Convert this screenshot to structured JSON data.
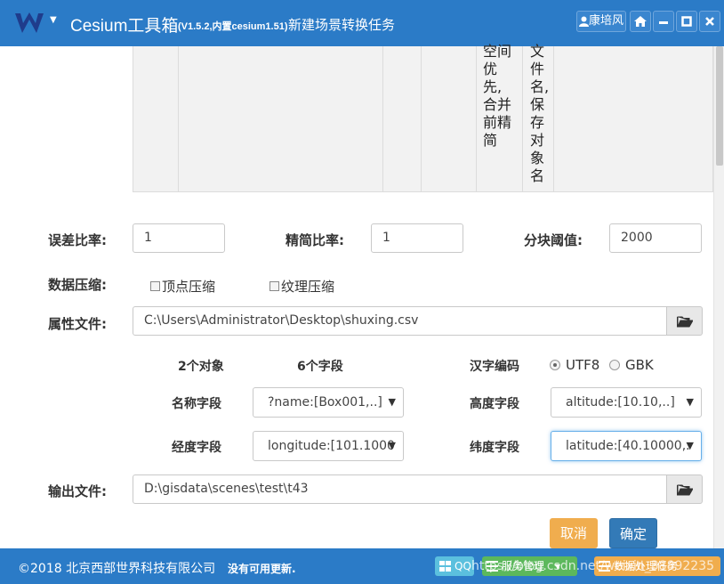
{
  "app": {
    "title": "Cesium工具箱",
    "version": "(V1.5.2,内置cesium1.51)",
    "subtitle": "新建场景转换任务",
    "user": "康培风"
  },
  "grid": {
    "col_a": "空间优先,合并前精简",
    "col_b": "文件名,保存对象名"
  },
  "form": {
    "error_ratio": {
      "label": "误差比率:",
      "value": "1"
    },
    "simplify_ratio": {
      "label": "精简比率:",
      "value": "1"
    },
    "tile_threshold": {
      "label": "分块阈值:",
      "value": "2000"
    },
    "compression": {
      "label": "数据压缩:",
      "vertex": "顶点压缩",
      "texture": "纹理压缩"
    },
    "attr_file": {
      "label": "属性文件:",
      "value": "C:\\Users\\Administrator\\Desktop\\shuxing.csv"
    },
    "object_count": "2个对象",
    "field_count": "6个字段",
    "encoding": {
      "label": "汉字编码",
      "options": [
        "UTF8",
        "GBK"
      ],
      "selected": "UTF8"
    },
    "name_field": {
      "label": "名称字段",
      "value": "?name:[Box001,..]"
    },
    "height_field": {
      "label": "高度字段",
      "value": "altitude:[10.10,..]"
    },
    "lon_field": {
      "label": "经度字段",
      "value": "longitude:[101.1000"
    },
    "lat_field": {
      "label": "纬度字段",
      "value": "latitude:[40.10000,."
    },
    "output_file": {
      "label": "输出文件:",
      "value": "D:\\gisdata\\scenes\\test\\t43"
    }
  },
  "buttons": {
    "cancel": "取消",
    "ok": "确定"
  },
  "status": {
    "copyright": "©2018 北京西部世界科技有限公司",
    "update": "没有可用更新.",
    "qq": "QQ",
    "service_mgmt": "服务管理",
    "data_mgmt": "数据处理任务",
    "watermark": "https://blog.csdn.net/weixin_38892235"
  },
  "colors": {
    "titlebar": "#2b7bc7",
    "cancel": "#f0ad4e",
    "ok": "#337ab7",
    "qq_btn": "#5bc0de",
    "service_btn": "#5cb85c",
    "data_btn": "#f0ad4e"
  }
}
